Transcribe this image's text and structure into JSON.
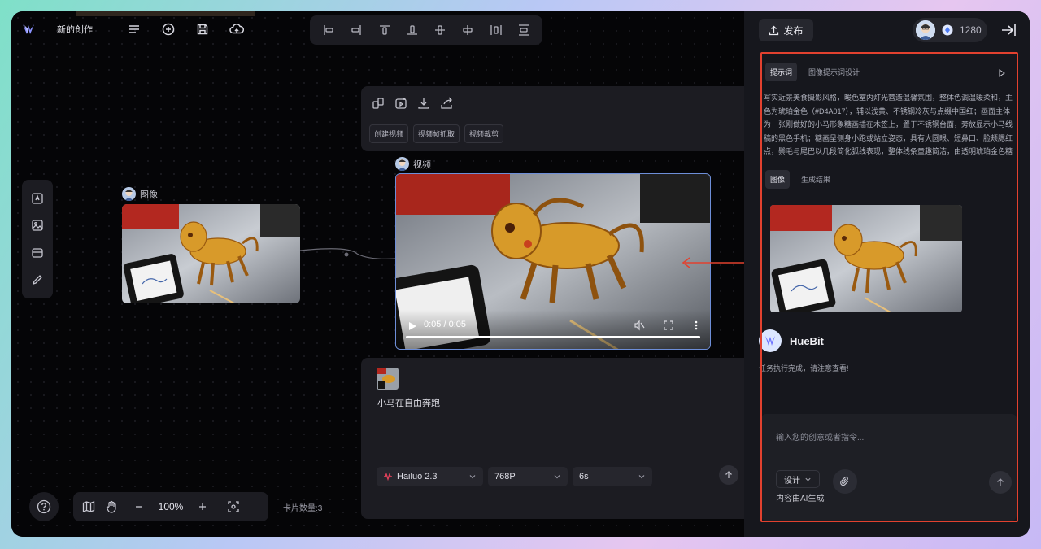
{
  "app": {
    "title": "新的创作"
  },
  "colors": {
    "accent": "#6d8ed8",
    "highlight": "#e2412f",
    "bg": "#050507",
    "panel": "#16171d"
  },
  "image_node": {
    "label": "图像"
  },
  "video_node": {
    "label": "视频",
    "time": "0:05 / 0:05",
    "progress": 1.0
  },
  "action_card": {
    "chips": [
      "创建视频",
      "视频帧抓取",
      "视频裁剪"
    ]
  },
  "prompt_card": {
    "text": "小马在自由奔跑",
    "model": "Hailuo 2.3",
    "resolution": "768P",
    "duration": "6s"
  },
  "zoom": {
    "value": "100%"
  },
  "card_count": "卡片数量:3",
  "panel": {
    "publish_label": "发布",
    "credits": "1280",
    "tabs_prompt": [
      "提示词",
      "图像提示词设计"
    ],
    "prompt_text": "写实近景美食摄影风格，暖色室内灯光营造温馨氛围，整体色调温暖柔和，主色为琥珀金色（#D4A017），辅以浅黄、不锈钢冷灰与点缀中国红；画面主体为一张刚做好的小马形象糖画插在木签上，置于不锈钢台面，旁放显示小马线稿的黑色手机；糖画呈侧身小跑或站立姿态，具有大圆眼、短鼻口、脸颊腮红点，鬃毛与尾巴以几段简化弧线表现，整体线条童趣简洁，由透明琥珀金色糖浆勾勒并局部填充，线条有轻微粗细变化，糖浆表面光泽强烈，可见细小气泡与凝固流纹",
    "tabs_result": [
      "图像",
      "生成结果"
    ],
    "bot_name": "HueBit",
    "bot_message": "任务执行完成，请注意查看!",
    "chat_placeholder": "输入您的创意或者指令...",
    "design_label": "设计",
    "ai_note": "内容由AI生成"
  }
}
